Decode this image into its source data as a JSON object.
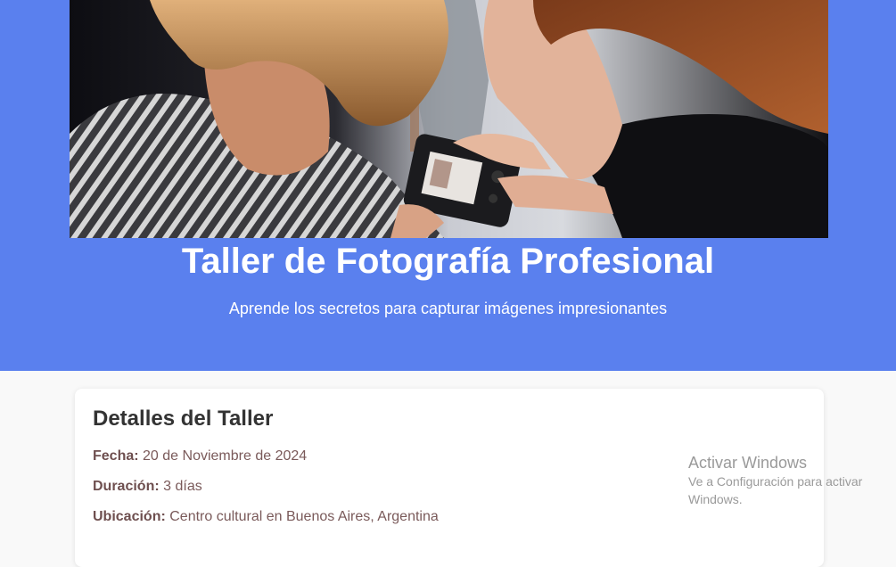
{
  "hero": {
    "image_alt": "Two people looking at a camera display",
    "title": "Taller de Fotografía Profesional",
    "subtitle": "Aprende los secretos para capturar imágenes impresionantes",
    "background_color": "#5a80ee"
  },
  "details": {
    "heading": "Detalles del Taller",
    "items": [
      {
        "label": "Fecha:",
        "value": "20 de Noviembre de 2024"
      },
      {
        "label": "Duración:",
        "value": "3 días"
      },
      {
        "label": "Ubicación:",
        "value": "Centro cultural en Buenos Aires, Argentina"
      }
    ]
  },
  "watermark": {
    "title": "Activar Windows",
    "line1": "Ve a Configuración para activar",
    "line2": "Windows."
  }
}
